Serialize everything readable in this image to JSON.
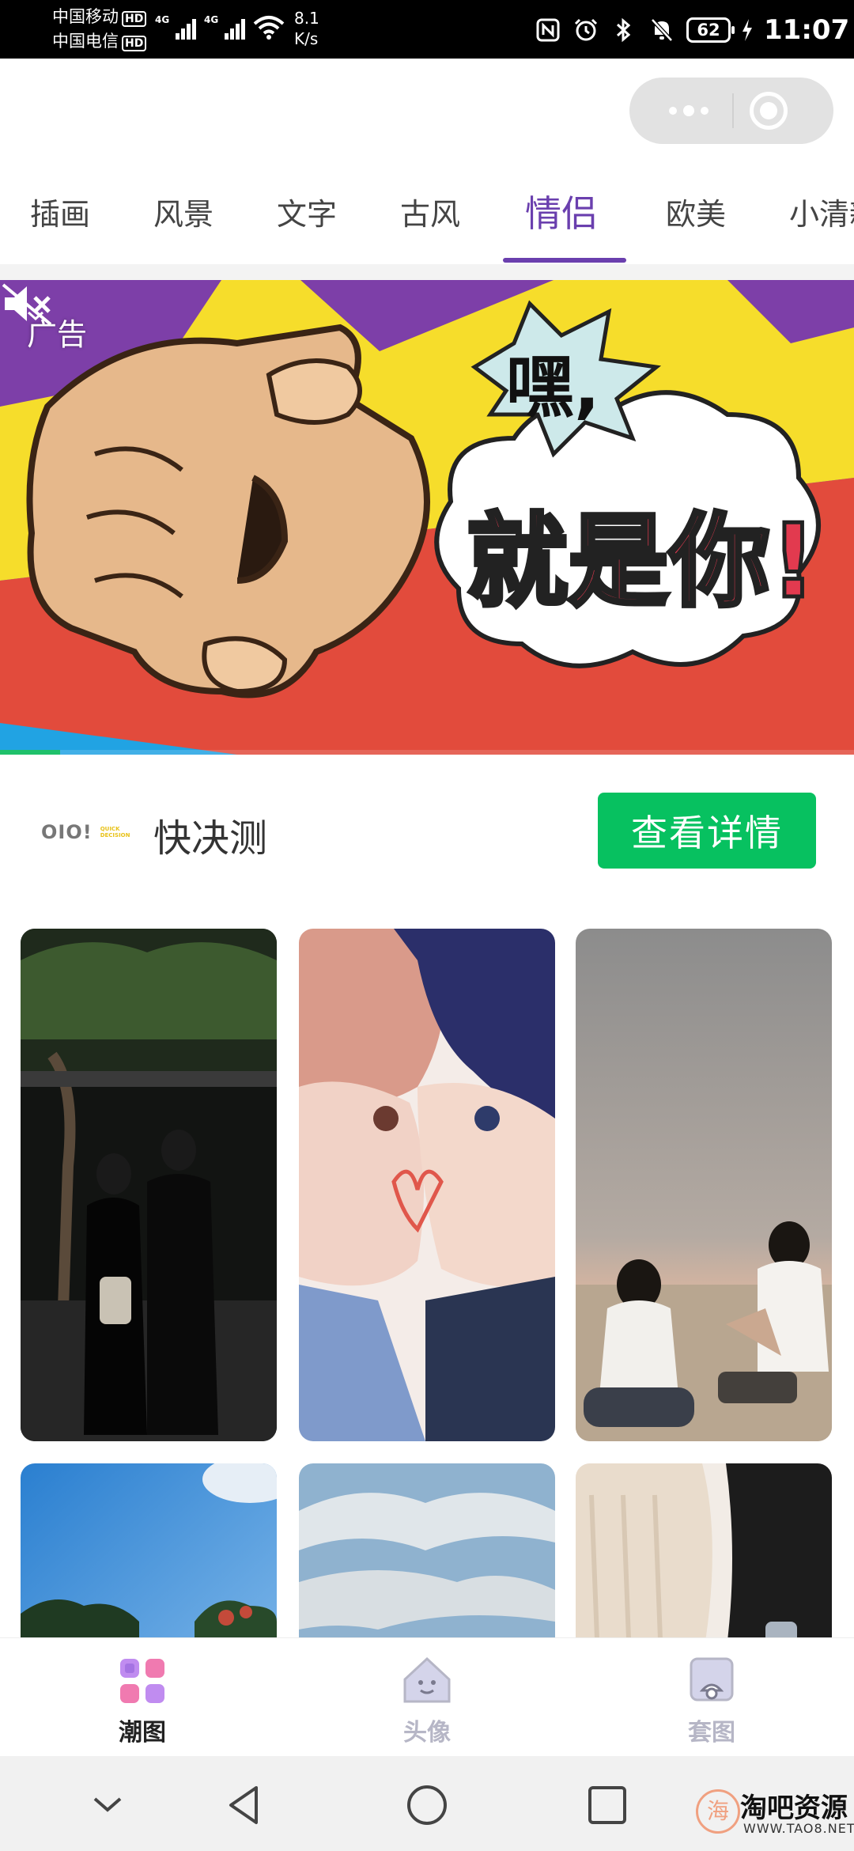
{
  "status_bar": {
    "carrier_1": "中国移动",
    "carrier_2": "中国电信",
    "hd_badge": "HD",
    "net_type": "4G",
    "net_speed_value": "8.1",
    "net_speed_unit": "K/s",
    "nfc_icon": "nfc-icon",
    "alarm_icon": "alarm-icon",
    "bluetooth_icon": "bluetooth-icon",
    "mute_icon": "notification-muted-icon",
    "battery": "62",
    "time": "11:07"
  },
  "capsule": {
    "more_icon": "more-dots-icon",
    "close_icon": "close-miniprogram-icon"
  },
  "tabs": [
    {
      "label": "插画",
      "active": false
    },
    {
      "label": "风景",
      "active": false
    },
    {
      "label": "文字",
      "active": false
    },
    {
      "label": "古风",
      "active": false
    },
    {
      "label": "情侣",
      "active": true
    },
    {
      "label": "欧美",
      "active": false
    },
    {
      "label": "小清新",
      "active": false
    }
  ],
  "ad": {
    "tag_label": "广告",
    "headline_small": "嘿,",
    "headline_big": "就是你!",
    "progress": 0.07,
    "mute_icon": "speaker-muted-icon",
    "advertiser_logo_text": "OIO!",
    "advertiser_logo_sub": "QUICK DECISION",
    "advertiser_name": "快决测",
    "cta_label": "查看详情",
    "cta_color": "#07c160"
  },
  "grid_items": [
    {
      "subject": "photo-couple-street-night"
    },
    {
      "subject": "illustration-anime-couple"
    },
    {
      "subject": "photo-couple-beach-dusk"
    },
    {
      "subject": "photo-sky-trees"
    },
    {
      "subject": "photo-sky-clouds"
    },
    {
      "subject": "photo-couple-sweaters"
    }
  ],
  "tabbar": {
    "items": [
      {
        "label": "潮图",
        "icon": "grid-squares-icon",
        "active": true
      },
      {
        "label": "头像",
        "icon": "avatar-house-icon",
        "active": false
      },
      {
        "label": "套图",
        "icon": "set-album-icon",
        "active": false
      }
    ],
    "active_color": "#222222",
    "inactive_color": "#b6b6c6",
    "accent_color": "#6a3fae"
  },
  "navbar": {
    "items": [
      "collapse-icon",
      "back-icon",
      "home-icon",
      "recents-icon"
    ]
  },
  "watermark": {
    "logo_char": "海",
    "title": "淘吧资源",
    "url": "WWW.TAO8.NET"
  }
}
